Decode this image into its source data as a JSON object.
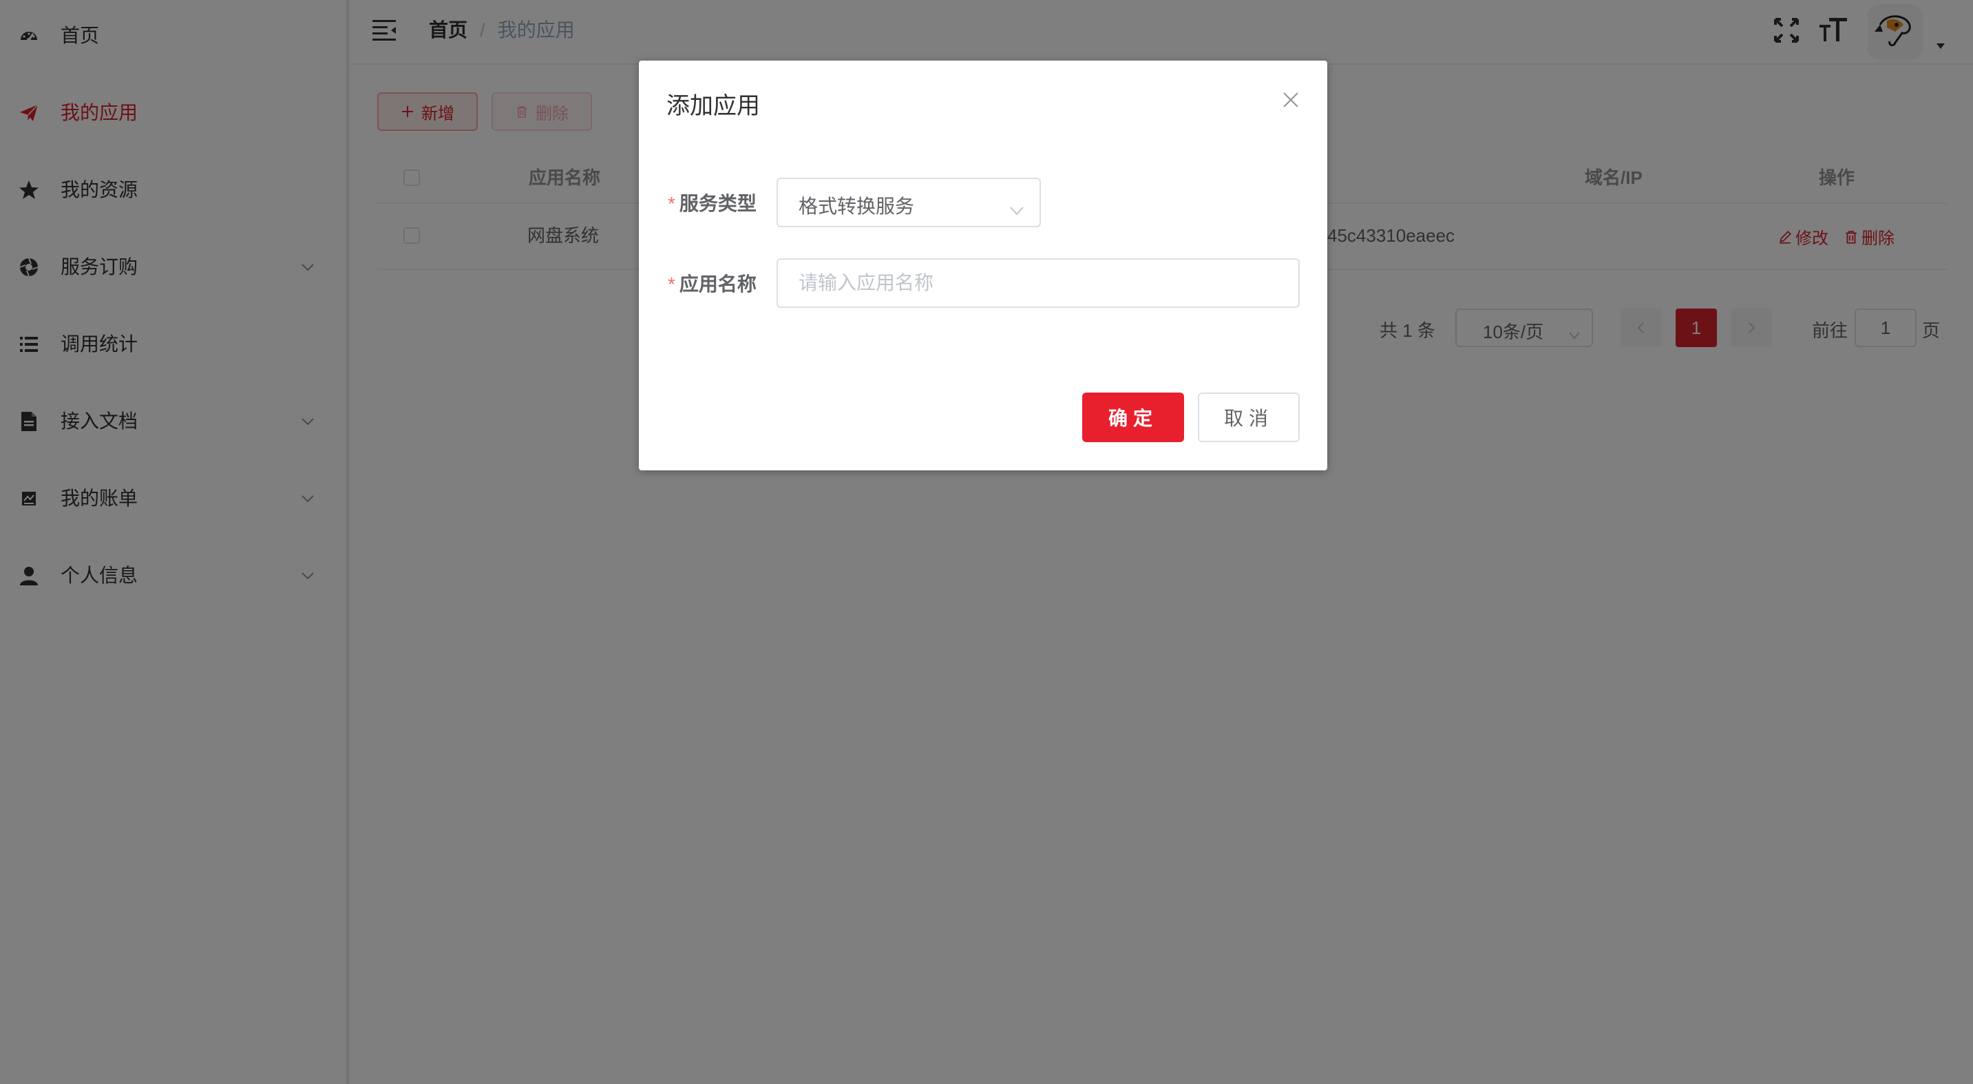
{
  "sidebar": {
    "items": [
      {
        "label": "首页"
      },
      {
        "label": "我的应用"
      },
      {
        "label": "我的资源"
      },
      {
        "label": "服务订购"
      },
      {
        "label": "调用统计"
      },
      {
        "label": "接入文档"
      },
      {
        "label": "我的账单"
      },
      {
        "label": "个人信息"
      }
    ]
  },
  "header": {
    "breadcrumb_home": "首页",
    "breadcrumb_sep": "/",
    "breadcrumb_current": "我的应用"
  },
  "toolbar": {
    "add_label": "新增",
    "delete_label": "删除"
  },
  "table": {
    "headers": {
      "name": "应用名称",
      "domain": "域名/IP",
      "ops": "操作"
    },
    "rows": [
      {
        "name": "网盘系统",
        "appkey_tail": "45c43310eaeec",
        "edit": "修改",
        "delete": "删除"
      }
    ]
  },
  "pagination": {
    "total": "共 1 条",
    "page_size": "10条/页",
    "current": "1",
    "goto_prefix": "前往",
    "goto_value": "1",
    "goto_suffix": "页"
  },
  "dialog": {
    "title": "添加应用",
    "service_type_label": "服务类型",
    "service_type_value": "格式转换服务",
    "app_name_label": "应用名称",
    "app_name_placeholder": "请输入应用名称",
    "app_name_value": "",
    "required_mark": "*",
    "ok_label": "确定",
    "cancel_label": "取消"
  },
  "colors": {
    "accent": "#d9232d",
    "primary_button": "#e8202e"
  }
}
